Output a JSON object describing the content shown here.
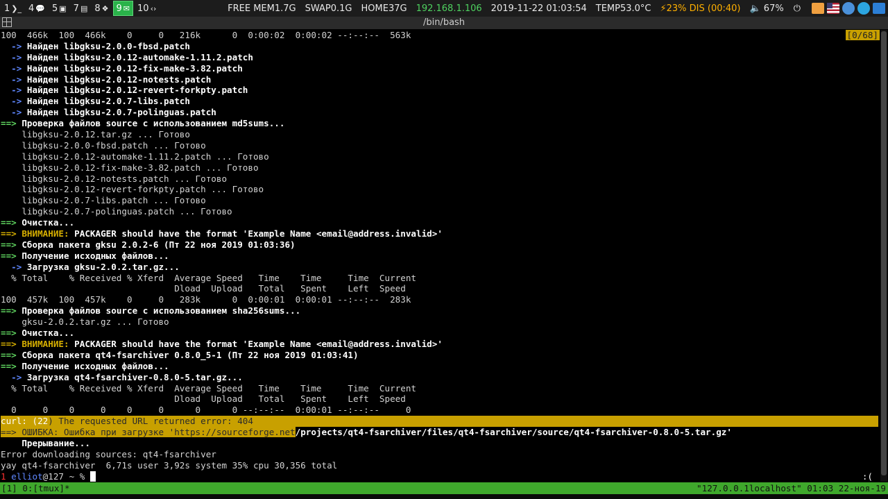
{
  "topbar": {
    "workspaces": [
      {
        "num": "1",
        "icon": "terminal-icon",
        "glyph": "❯_",
        "active": false
      },
      {
        "num": "4",
        "icon": "chat-icon",
        "glyph": "💬",
        "active": false
      },
      {
        "num": "5",
        "icon": "image-icon",
        "glyph": "▣",
        "active": false
      },
      {
        "num": "7",
        "icon": "document-icon",
        "glyph": "▤",
        "active": false
      },
      {
        "num": "8",
        "icon": "film-icon",
        "glyph": "❖",
        "active": false
      },
      {
        "num": "9",
        "icon": "mail-icon",
        "glyph": "✉",
        "active": true
      },
      {
        "num": "10",
        "icon": "code-icon",
        "glyph": "‹›",
        "active": false
      }
    ],
    "mem": "FREE MEM1.7G",
    "swap": "SWAP0.1G",
    "home": "HOME37G",
    "ip": "192.168.1.106",
    "datetime": "2019-11-22 01:03:54",
    "temp": "TEMP53.0°C",
    "battery": "⚡23% DIS (00:40)",
    "volume": "🔈 67%",
    "power_glyph": "⏻",
    "colors": {
      "ip": "#4ed15f",
      "battery": "#ffb000",
      "active_ws": "#2ab34a"
    }
  },
  "window": {
    "title": "/bin/bash"
  },
  "terminal": {
    "counter": "[0/68]",
    "lines": [
      {
        "segs": [
          {
            "t": "100  466k  100  466k    0     0   216k      0  0:00:02  0:00:02 --:--:--  563k",
            "c": ""
          }
        ]
      },
      {
        "segs": [
          {
            "t": "  -> ",
            "c": "blue b"
          },
          {
            "t": "Найден libgksu-2.0.0-fbsd.patch",
            "c": "white b"
          }
        ]
      },
      {
        "segs": [
          {
            "t": "  -> ",
            "c": "blue b"
          },
          {
            "t": "Найден libgksu-2.0.12-automake-1.11.2.patch",
            "c": "white b"
          }
        ]
      },
      {
        "segs": [
          {
            "t": "  -> ",
            "c": "blue b"
          },
          {
            "t": "Найден libgksu-2.0.12-fix-make-3.82.patch",
            "c": "white b"
          }
        ]
      },
      {
        "segs": [
          {
            "t": "  -> ",
            "c": "blue b"
          },
          {
            "t": "Найден libgksu-2.0.12-notests.patch",
            "c": "white b"
          }
        ]
      },
      {
        "segs": [
          {
            "t": "  -> ",
            "c": "blue b"
          },
          {
            "t": "Найден libgksu-2.0.12-revert-forkpty.patch",
            "c": "white b"
          }
        ]
      },
      {
        "segs": [
          {
            "t": "  -> ",
            "c": "blue b"
          },
          {
            "t": "Найден libgksu-2.0.7-libs.patch",
            "c": "white b"
          }
        ]
      },
      {
        "segs": [
          {
            "t": "  -> ",
            "c": "blue b"
          },
          {
            "t": "Найден libgksu-2.0.7-polinguas.patch",
            "c": "white b"
          }
        ]
      },
      {
        "segs": [
          {
            "t": "==> ",
            "c": "green b"
          },
          {
            "t": "Проверка файлов source с использованием md5sums...",
            "c": "white b"
          }
        ]
      },
      {
        "segs": [
          {
            "t": "    libgksu-2.0.12.tar.gz ... Готово",
            "c": ""
          }
        ]
      },
      {
        "segs": [
          {
            "t": "    libgksu-2.0.0-fbsd.patch ... Готово",
            "c": ""
          }
        ]
      },
      {
        "segs": [
          {
            "t": "    libgksu-2.0.12-automake-1.11.2.patch ... Готово",
            "c": ""
          }
        ]
      },
      {
        "segs": [
          {
            "t": "    libgksu-2.0.12-fix-make-3.82.patch ... Готово",
            "c": ""
          }
        ]
      },
      {
        "segs": [
          {
            "t": "    libgksu-2.0.12-notests.patch ... Готово",
            "c": ""
          }
        ]
      },
      {
        "segs": [
          {
            "t": "    libgksu-2.0.12-revert-forkpty.patch ... Готово",
            "c": ""
          }
        ]
      },
      {
        "segs": [
          {
            "t": "    libgksu-2.0.7-libs.patch ... Готово",
            "c": ""
          }
        ]
      },
      {
        "segs": [
          {
            "t": "    libgksu-2.0.7-polinguas.patch ... Готово",
            "c": ""
          }
        ]
      },
      {
        "segs": [
          {
            "t": "==> ",
            "c": "green b"
          },
          {
            "t": "Очистка...",
            "c": "white b"
          }
        ]
      },
      {
        "segs": [
          {
            "t": "==> ",
            "c": "yellow b"
          },
          {
            "t": "ВНИМАНИЕ: ",
            "c": "yellow b"
          },
          {
            "t": "PACKAGER should have the format 'Example Name <email@address.invalid>'",
            "c": "white b"
          }
        ]
      },
      {
        "segs": [
          {
            "t": "==> ",
            "c": "green b"
          },
          {
            "t": "Сборка пакета gksu 2.0.2-6 (Пт 22 ноя 2019 01:03:36)",
            "c": "white b"
          }
        ]
      },
      {
        "segs": [
          {
            "t": "==> ",
            "c": "green b"
          },
          {
            "t": "Получение исходных файлов...",
            "c": "white b"
          }
        ]
      },
      {
        "segs": [
          {
            "t": "  -> ",
            "c": "blue b"
          },
          {
            "t": "Загрузка gksu-2.0.2.tar.gz...",
            "c": "white b"
          }
        ]
      },
      {
        "segs": [
          {
            "t": "  % Total    % Received % Xferd  Average Speed   Time    Time     Time  Current",
            "c": ""
          }
        ]
      },
      {
        "segs": [
          {
            "t": "                                 Dload  Upload   Total   Spent    Left  Speed",
            "c": ""
          }
        ]
      },
      {
        "segs": [
          {
            "t": "100  457k  100  457k    0     0   283k      0  0:00:01  0:00:01 --:--:--  283k",
            "c": ""
          }
        ]
      },
      {
        "segs": [
          {
            "t": "==> ",
            "c": "green b"
          },
          {
            "t": "Проверка файлов source с использованием sha256sums...",
            "c": "white b"
          }
        ]
      },
      {
        "segs": [
          {
            "t": "    gksu-2.0.2.tar.gz ... Готово",
            "c": ""
          }
        ]
      },
      {
        "segs": [
          {
            "t": "==> ",
            "c": "green b"
          },
          {
            "t": "Очистка...",
            "c": "white b"
          }
        ]
      },
      {
        "segs": [
          {
            "t": "==> ",
            "c": "yellow b"
          },
          {
            "t": "ВНИМАНИЕ: ",
            "c": "yellow b"
          },
          {
            "t": "PACKAGER should have the format 'Example Name <email@address.invalid>'",
            "c": "white b"
          }
        ]
      },
      {
        "segs": [
          {
            "t": "==> ",
            "c": "green b"
          },
          {
            "t": "Сборка пакета qt4-fsarchiver 0.8.0_5-1 (Пт 22 ноя 2019 01:03:41)",
            "c": "white b"
          }
        ]
      },
      {
        "segs": [
          {
            "t": "==> ",
            "c": "green b"
          },
          {
            "t": "Получение исходных файлов...",
            "c": "white b"
          }
        ]
      },
      {
        "segs": [
          {
            "t": "  -> ",
            "c": "blue b"
          },
          {
            "t": "Загрузка qt4-fsarchiver-0.8.0-5.tar.gz...",
            "c": "white b"
          }
        ]
      },
      {
        "segs": [
          {
            "t": "  % Total    % Received % Xferd  Average Speed   Time    Time     Time  Current",
            "c": ""
          }
        ]
      },
      {
        "segs": [
          {
            "t": "                                 Dload  Upload   Total   Spent    Left  Speed",
            "c": ""
          }
        ]
      },
      {
        "segs": [
          {
            "t": "  0     0    0     0    0     0      0      0 --:--:--  0:00:01 --:--:--     0",
            "c": ""
          }
        ]
      },
      {
        "hl": true,
        "segs": [
          {
            "t": "curl: (22",
            "c": "w"
          },
          {
            "t": ") The requested URL returned error: 404",
            "c": ""
          }
        ]
      },
      {
        "segs": [
          {
            "t": "==> ",
            "c": "hl"
          },
          {
            "t": "ОШИБКА: Ошибка при загрузке 'https://sourceforge.net",
            "c": "hl"
          },
          {
            "t": "/projects/qt4-fsarchiver/files/qt4-fsarchiver/source/qt4-fsarchiver-0.8.0-5.tar.gz'",
            "c": "white b"
          }
        ]
      },
      {
        "segs": [
          {
            "t": "    Прерывание...",
            "c": "white b"
          }
        ]
      },
      {
        "segs": [
          {
            "t": "Error downloading sources: qt4-fsarchiver",
            "c": ""
          }
        ]
      },
      {
        "segs": [
          {
            "t": "yay qt4-fsarchiver  6,71s user 3,92s system 35% cpu 30,356 total",
            "c": ""
          }
        ]
      },
      {
        "segs": [
          {
            "t": "1 ",
            "c": "red"
          },
          {
            "t": "elliot",
            "c": "blue"
          },
          {
            "t": "@127 ~ % ",
            "c": ""
          }
        ]
      }
    ],
    "right_note": ":("
  },
  "tmux": {
    "left": "[1] 0:[tmux]*",
    "right": "\"127.0.0.1localhost\" 01:03 22-ноя-19"
  }
}
